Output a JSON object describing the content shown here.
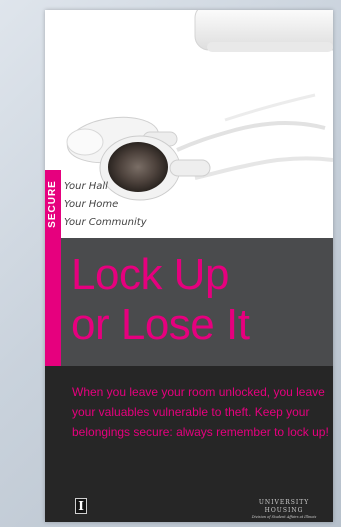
{
  "poster": {
    "secure_label": "SECURE",
    "taglines": [
      "Your Hall",
      "Your Home",
      "Your Community"
    ],
    "headline_lines": [
      "Lock Up",
      "or Lose It"
    ],
    "body": "When you leave your room unlocked, you leave your valuables vulnerable to theft. Keep your belongings secure: always remember to lock up!",
    "logo_letter": "I",
    "housing_title": "UNIVERSITY HOUSING",
    "housing_subtitle": "Division of Student Affairs at Illinois"
  },
  "colors": {
    "accent": "#e6007e",
    "headline_band": "#4a4b4d",
    "body_band": "#262626",
    "background": "#c9d2dc"
  },
  "icons": [
    "earbuds-illustration",
    "mp3-player-illustration",
    "university-logo-icon"
  ]
}
